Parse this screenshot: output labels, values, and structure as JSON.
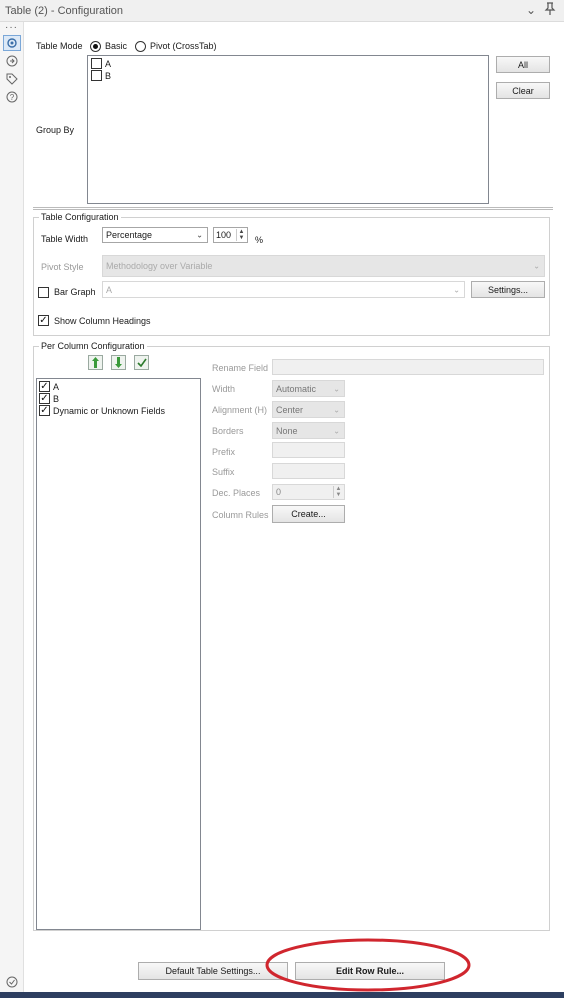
{
  "window": {
    "title": "Table (2) - Configuration"
  },
  "rail": {
    "icons": [
      "more-dots-icon",
      "gear-icon",
      "connection-icon",
      "tag-icon",
      "help-icon",
      "check-circle-icon"
    ]
  },
  "table_mode": {
    "label": "Table Mode",
    "options": [
      {
        "label": "Basic",
        "selected": true
      },
      {
        "label": "Pivot (CrossTab)",
        "selected": false
      }
    ]
  },
  "group_by": {
    "label": "Group By",
    "items": [
      {
        "label": "A",
        "checked": false
      },
      {
        "label": "B",
        "checked": false
      }
    ],
    "all_button": "All",
    "clear_button": "Clear"
  },
  "table_config": {
    "title": "Table Configuration",
    "width_label": "Table Width",
    "width_mode": "Percentage",
    "width_value": "100",
    "width_unit": "%",
    "pivot_style_label": "Pivot Style",
    "pivot_style_value": "Methodology over Variable",
    "bar_graph_label": "Bar Graph",
    "bar_graph_checked": false,
    "bar_graph_field": "A",
    "settings_button": "Settings...",
    "show_headings_label": "Show Column Headings",
    "show_headings_checked": true
  },
  "per_column": {
    "title": "Per Column Configuration",
    "fields": [
      {
        "label": "A",
        "checked": true
      },
      {
        "label": "B",
        "checked": true
      },
      {
        "label": "Dynamic or Unknown Fields",
        "checked": true
      }
    ],
    "rename_label": "Rename Field",
    "width_label": "Width",
    "width_value": "Automatic",
    "alignment_label": "Alignment (H)",
    "alignment_value": "Center",
    "borders_label": "Borders",
    "borders_value": "None",
    "prefix_label": "Prefix",
    "suffix_label": "Suffix",
    "dec_places_label": "Dec. Places",
    "dec_places_value": "0",
    "column_rules_label": "Column Rules",
    "create_button": "Create..."
  },
  "footer": {
    "default_settings_button": "Default Table Settings...",
    "edit_row_rule_button": "Edit Row Rule..."
  },
  "colors": {
    "annotation_ellipse": "#d0262e",
    "bottom_bar": "#2d3e60",
    "up_arrow": "#3a9a3a",
    "down_arrow": "#3a9a3a"
  }
}
